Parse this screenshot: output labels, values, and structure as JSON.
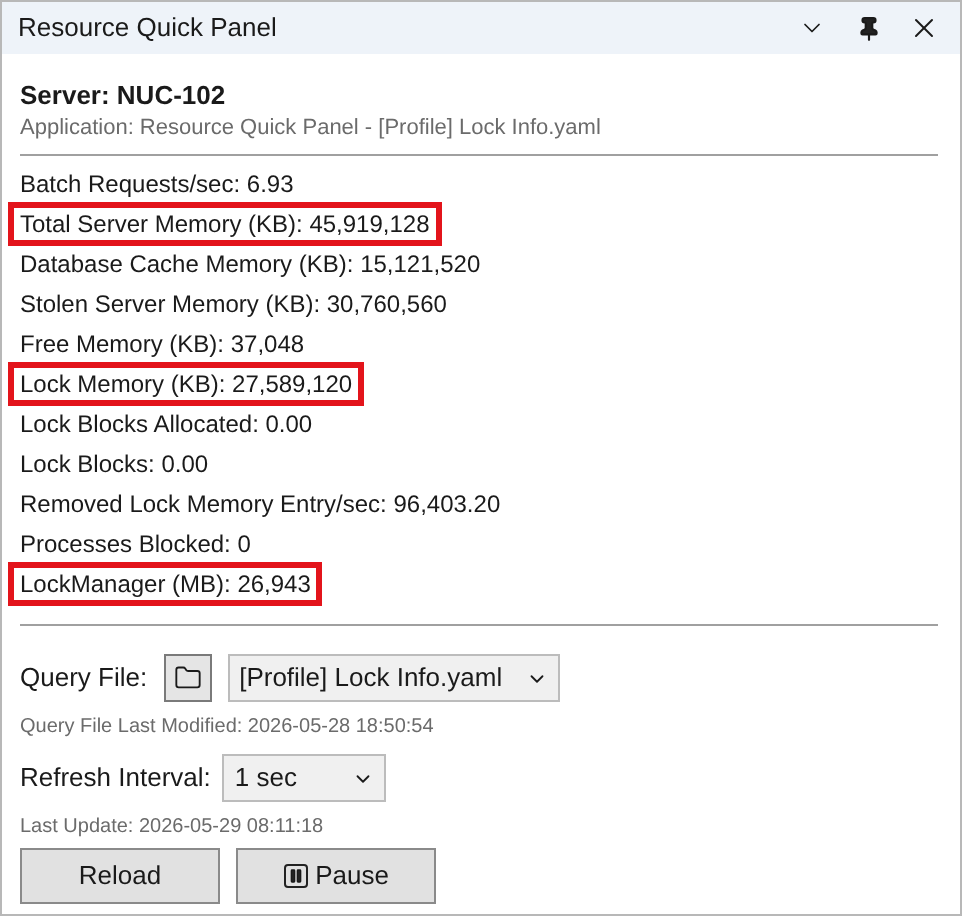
{
  "window": {
    "title": "Resource Quick Panel"
  },
  "server": "Server: NUC-102",
  "application": "Application: Resource Quick Panel - [Profile] Lock Info.yaml",
  "metrics": [
    {
      "text": "Batch Requests/sec: 6.93",
      "highlighted": false
    },
    {
      "text": "Total Server Memory (KB): 45,919,128",
      "highlighted": true
    },
    {
      "text": "Database Cache Memory (KB): 15,121,520",
      "highlighted": false
    },
    {
      "text": "Stolen Server Memory (KB): 30,760,560",
      "highlighted": false
    },
    {
      "text": "Free Memory (KB): 37,048",
      "highlighted": false
    },
    {
      "text": "Lock Memory (KB): 27,589,120",
      "highlighted": true
    },
    {
      "text": "Lock Blocks Allocated: 0.00",
      "highlighted": false
    },
    {
      "text": "Lock Blocks: 0.00",
      "highlighted": false
    },
    {
      "text": "Removed Lock Memory Entry/sec: 96,403.20",
      "highlighted": false
    },
    {
      "text": "Processes Blocked: 0",
      "highlighted": false
    },
    {
      "text": "LockManager (MB): 26,943",
      "highlighted": true
    }
  ],
  "query_file": {
    "label": "Query File:",
    "value": "[Profile] Lock Info.yaml",
    "last_modified": "Query File Last Modified: 2026-05-28 18:50:54"
  },
  "refresh": {
    "label": "Refresh Interval:",
    "value": "1 sec",
    "last_update": "Last Update: 2026-05-29 08:11:18"
  },
  "buttons": [
    {
      "label": "Reload",
      "kind": "plain"
    },
    {
      "label": "Pause",
      "kind": "pause"
    }
  ]
}
